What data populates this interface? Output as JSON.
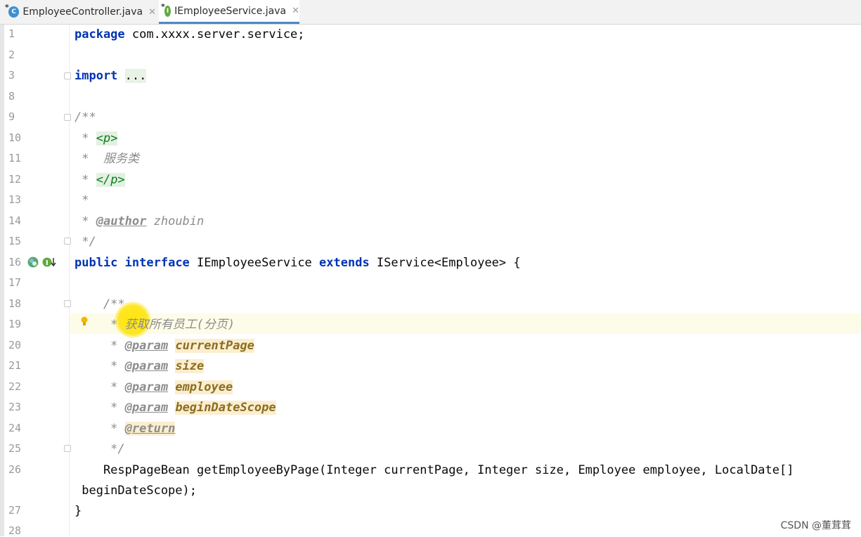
{
  "tabs": [
    {
      "label": "EmployeeController.java",
      "icon": "class-icon",
      "modified": true
    },
    {
      "label": "IEmployeeService.java",
      "icon": "interface-icon",
      "modified": true
    }
  ],
  "editor": {
    "line_numbers": [
      "1",
      "2",
      "3",
      "8",
      "9",
      "10",
      "11",
      "12",
      "13",
      "14",
      "15",
      "16",
      "17",
      "18",
      "19",
      "20",
      "21",
      "22",
      "23",
      "24",
      "25",
      "26",
      "",
      "27",
      "28"
    ],
    "lines": {
      "package_kw": "package",
      "package_name": " com.xxxx.server.service;",
      "import_kw": "import",
      "import_dots": "...",
      "jd_open": "/**",
      "star": " * ",
      "p_open": "<p>",
      "desc_cn": " 服务类",
      "p_close": "</p>",
      "star_only": " *",
      "author_tag": "@author",
      "author_name": " zhoubin",
      "jd_close": " */",
      "kw_public": "public",
      "kw_interface": "interface",
      "iface_name": " IEmployeeService ",
      "kw_extends": "extends",
      "iface_rest": " IService<Employee> {",
      "m_jd_open": "    /**",
      "m_star": "     * ",
      "m_desc": "获取所有员工(分页)",
      "param_tag": "@param",
      "p1": "currentPage",
      "p2": "size",
      "p3": "employee",
      "p4": "beginDateScope",
      "return_tag": "@return",
      "m_jd_close": "     */",
      "method_sig": "    RespPageBean getEmployeeByPage(Integer currentPage, Integer size, Employee employee, LocalDate[]",
      "method_sig_wrap": " beginDateScope);",
      "close_brace": "}"
    }
  },
  "watermark": "CSDN @董茸茸",
  "colors": {
    "keyword": "#0033b3",
    "comment": "#8c8c8c",
    "tag": "#067d17",
    "highlight": "#fdfce8",
    "tab_underline": "#4a88c7"
  }
}
